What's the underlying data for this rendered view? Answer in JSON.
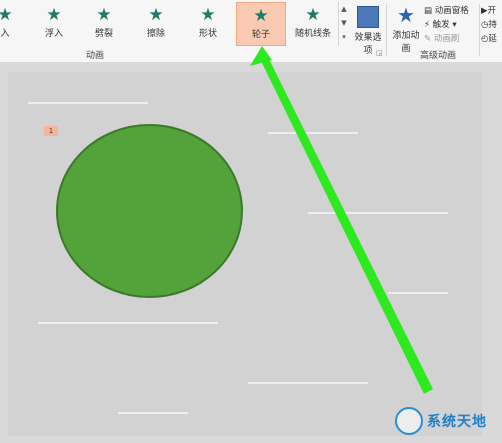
{
  "ribbon": {
    "animations": [
      {
        "label": "入",
        "selected": false
      },
      {
        "label": "浮入",
        "selected": false
      },
      {
        "label": "劈裂",
        "selected": false
      },
      {
        "label": "擦除",
        "selected": false
      },
      {
        "label": "形状",
        "selected": false
      },
      {
        "label": "轮子",
        "selected": true
      },
      {
        "label": "随机线条",
        "selected": false
      }
    ],
    "effect_options_label": "效果选项",
    "add_animation_label": "添加动画",
    "animation_pane_label": "动画窗格",
    "trigger_label": "触发",
    "animation_painter_label": "动画刷",
    "timing_start_label": "开",
    "timing_duration_label": "持",
    "timing_delay_label": "延",
    "group_animation_label": "动画",
    "group_advanced_label": "高级动画"
  },
  "slide": {
    "animation_badge": "1",
    "circle_color": "#54a23a"
  },
  "watermark": {
    "text": "系统天地"
  },
  "colors": {
    "arrow": "#2ee820",
    "selected_bg": "#f9c9b2"
  }
}
